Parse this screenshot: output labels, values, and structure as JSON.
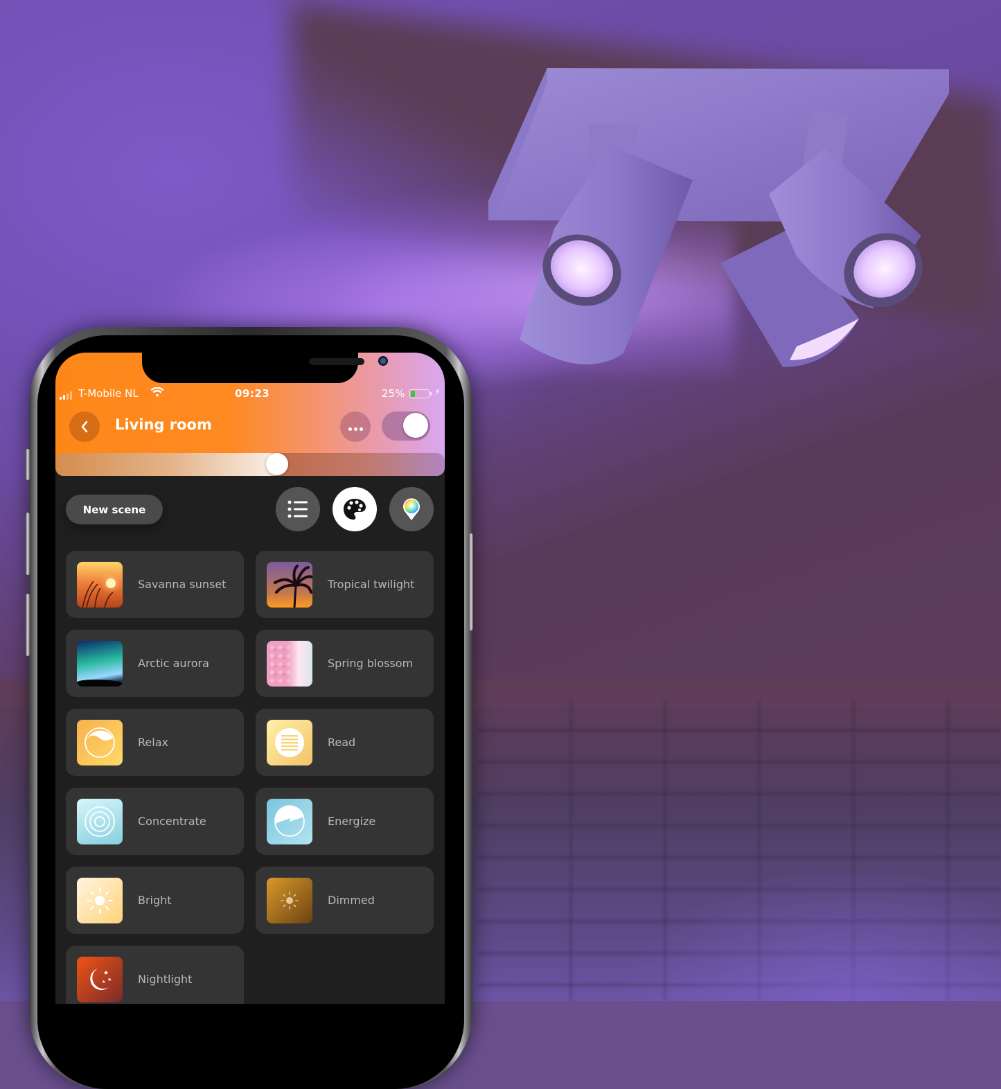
{
  "status_bar": {
    "carrier": "T-Mobile NL",
    "time": "09:23",
    "battery_percent_label": "25%",
    "battery_level": 0.25,
    "signal_bars_active": 2,
    "signal_bars_total": 4,
    "charging": true
  },
  "header": {
    "title": "Living room",
    "back_icon": "chevron-left-icon",
    "more_icon": "more-horizontal-icon",
    "power_on": true,
    "brightness_fraction": 0.57,
    "gradient_colors": [
      "#ff8719",
      "#f2957a",
      "#d9a7f2"
    ]
  },
  "toolbar": {
    "new_scene_label": "New scene",
    "views": [
      {
        "name": "list",
        "icon": "list-icon",
        "active": false
      },
      {
        "name": "palette",
        "icon": "palette-icon",
        "active": true
      },
      {
        "name": "color-picker",
        "icon": "color-pin-icon",
        "active": false
      }
    ]
  },
  "scenes": [
    {
      "label": "Savanna sunset",
      "icon": "savanna-sunset-photo",
      "colors": [
        "#ffd46a",
        "#f0803a",
        "#b8441c"
      ]
    },
    {
      "label": "Tropical twilight",
      "icon": "tropical-twilight-photo",
      "colors": [
        "#7a5aa0",
        "#c77a4a",
        "#ff9a20"
      ]
    },
    {
      "label": "Arctic aurora",
      "icon": "arctic-aurora-photo",
      "colors": [
        "#0a2a6a",
        "#2ab8a0",
        "#9ad8ff"
      ]
    },
    {
      "label": "Spring blossom",
      "icon": "spring-blossom-photo",
      "colors": [
        "#f0a0c0",
        "#ffe6ee",
        "#d8e6ec"
      ]
    },
    {
      "label": "Relax",
      "icon": "relax-icon",
      "colors": [
        "#f7b14e",
        "#ffd966"
      ]
    },
    {
      "label": "Read",
      "icon": "read-icon",
      "colors": [
        "#fff1a6",
        "#f4c36a"
      ]
    },
    {
      "label": "Concentrate",
      "icon": "concentrate-icon",
      "colors": [
        "#d7f6fb",
        "#86cfdf"
      ]
    },
    {
      "label": "Energize",
      "icon": "energize-icon",
      "colors": [
        "#7bc5dd",
        "#b4e4ef"
      ]
    },
    {
      "label": "Bright",
      "icon": "bright-icon",
      "colors": [
        "#fff5e0",
        "#ffd27a"
      ]
    },
    {
      "label": "Dimmed",
      "icon": "dimmed-icon",
      "colors": [
        "#d99a2a",
        "#6b4214"
      ]
    },
    {
      "label": "Nightlight",
      "icon": "nightlight-icon",
      "colors": [
        "#f05414",
        "#7a2a2a"
      ]
    }
  ]
}
